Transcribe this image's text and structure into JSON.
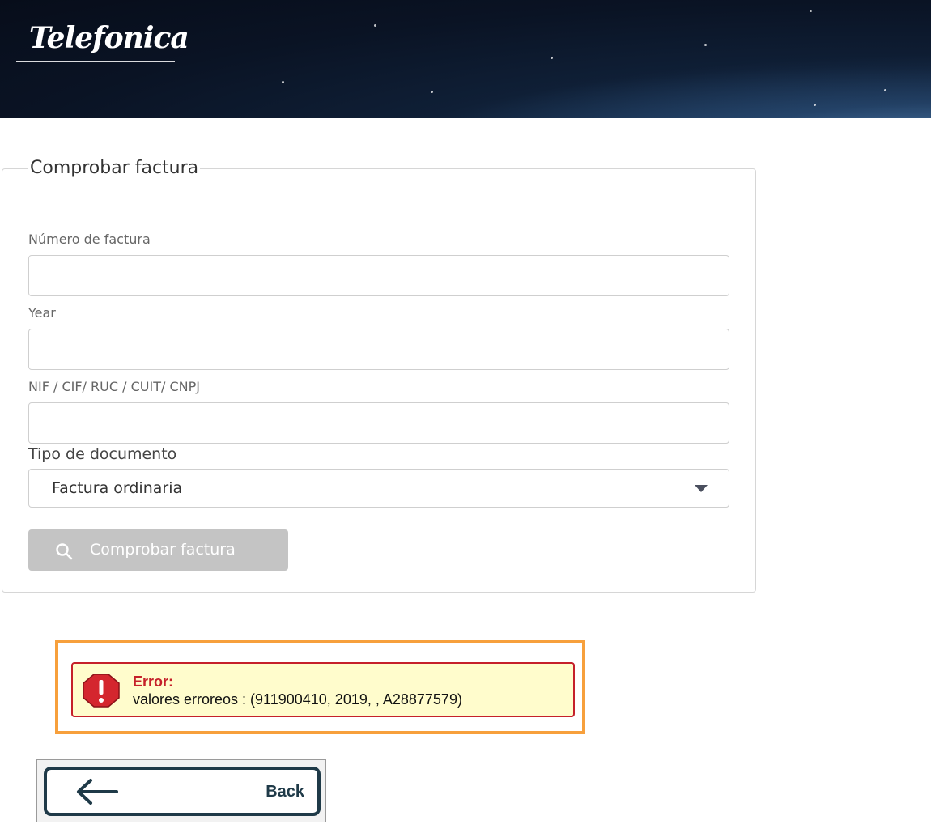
{
  "header": {
    "logo_text": "Telefonica"
  },
  "form": {
    "legend": "Comprobar factura",
    "fields": [
      {
        "label": "Número de factura",
        "value": ""
      },
      {
        "label": "Year",
        "value": ""
      },
      {
        "label": "NIF / CIF/ RUC / CUIT/ CNPJ",
        "value": ""
      }
    ],
    "document_type": {
      "label": "Tipo de documento",
      "selected": "Factura ordinaria"
    },
    "submit_label": "Comprobar factura"
  },
  "error": {
    "title": "Error:",
    "message": "valores erroreos : (911900410, 2019, , A28877579)"
  },
  "back": {
    "label": "Back"
  },
  "colors": {
    "error_border": "#c5202a",
    "error_background": "#fffccc",
    "highlight_frame": "#f7a03c",
    "button_disabled": "#c4c4c4",
    "back_border": "#1f3a48"
  },
  "icons": [
    "search-icon",
    "error-stop-icon",
    "arrow-left-icon",
    "chevron-down-icon"
  ]
}
